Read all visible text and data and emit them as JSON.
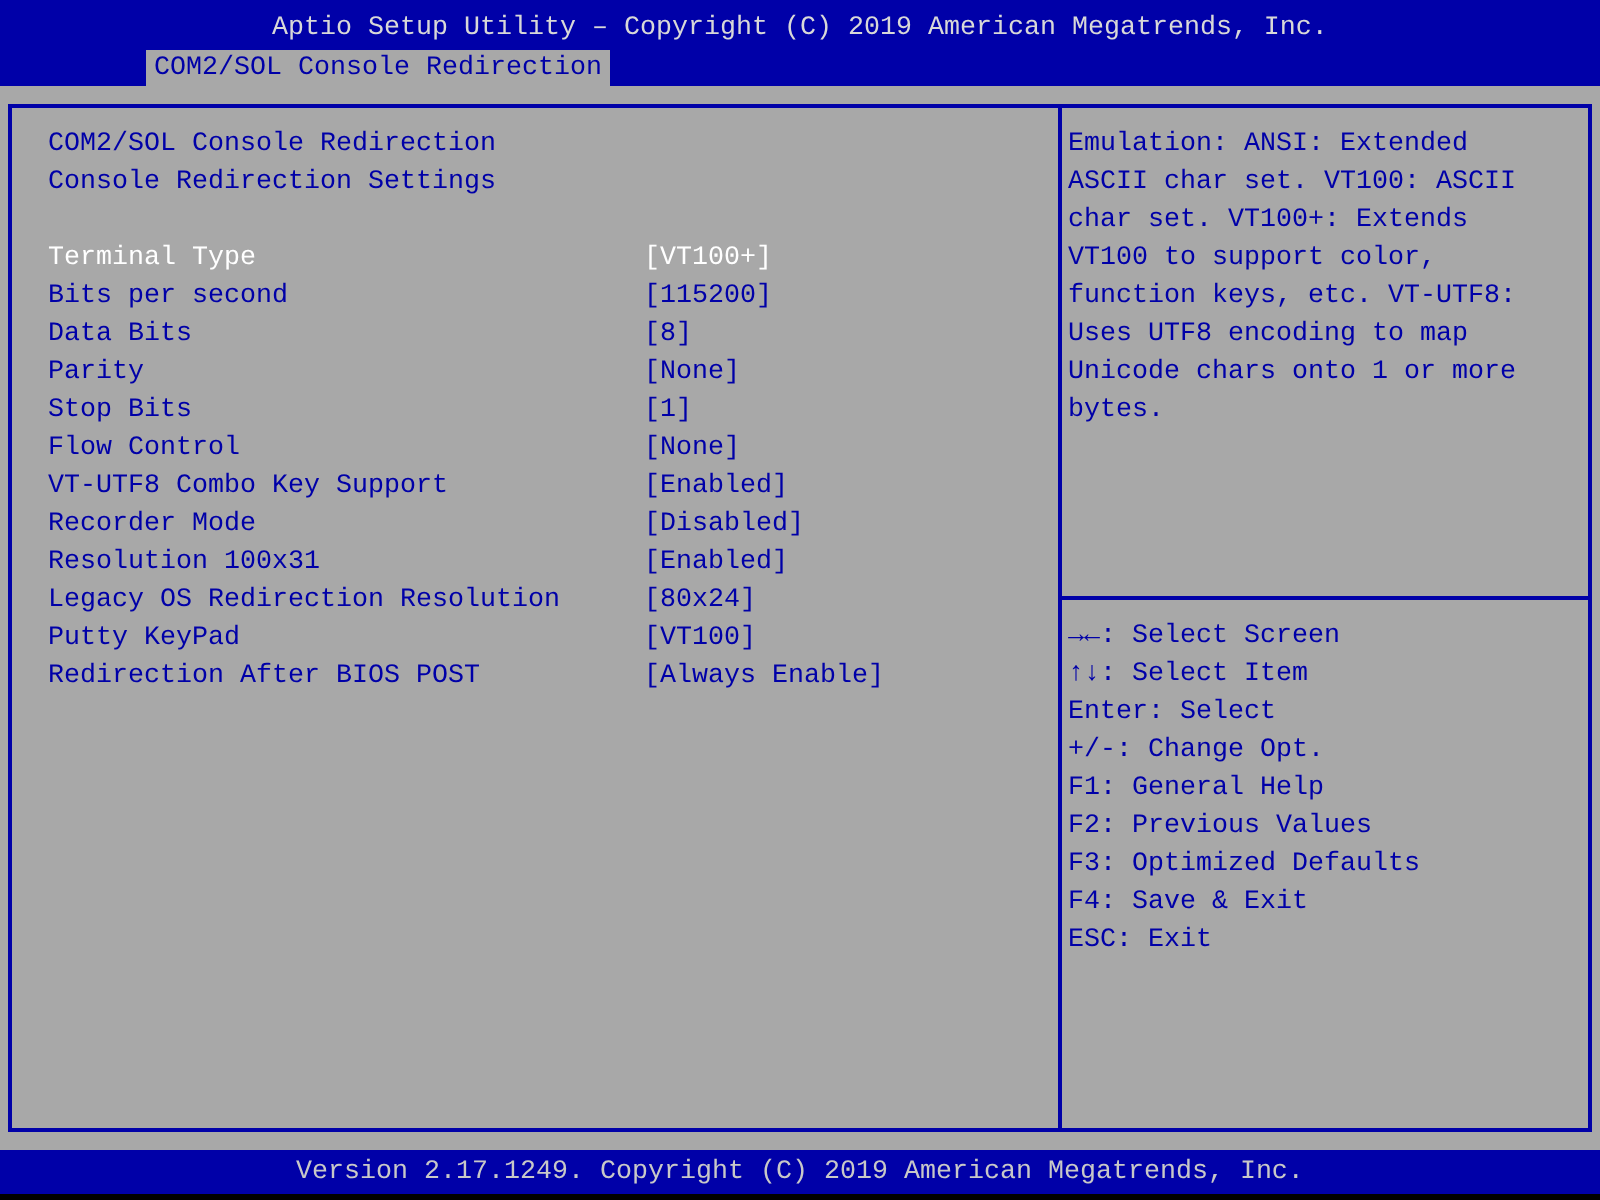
{
  "header": {
    "title": "Aptio Setup Utility – Copyright (C) 2019 American Megatrends, Inc.",
    "tabs": [
      {
        "label": "COM2/SOL Console Redirection",
        "selected": true
      }
    ]
  },
  "headings": [
    "COM2/SOL Console Redirection",
    "Console Redirection Settings"
  ],
  "settings": [
    {
      "label": "Terminal Type",
      "value": "[VT100+]",
      "selected": true
    },
    {
      "label": "Bits per second",
      "value": "[115200]",
      "selected": false
    },
    {
      "label": "Data Bits",
      "value": "[8]",
      "selected": false
    },
    {
      "label": "Parity",
      "value": "[None]",
      "selected": false
    },
    {
      "label": "Stop Bits",
      "value": "[1]",
      "selected": false
    },
    {
      "label": "Flow Control",
      "value": "[None]",
      "selected": false
    },
    {
      "label": "VT-UTF8 Combo Key Support",
      "value": "[Enabled]",
      "selected": false
    },
    {
      "label": "Recorder Mode",
      "value": "[Disabled]",
      "selected": false
    },
    {
      "label": "Resolution 100x31",
      "value": "[Enabled]",
      "selected": false
    },
    {
      "label": "Legacy OS Redirection Resolution",
      "value": "[80x24]",
      "selected": false
    },
    {
      "label": "Putty KeyPad",
      "value": "[VT100]",
      "selected": false
    },
    {
      "label": "Redirection After BIOS POST",
      "value": "[Always Enable]",
      "selected": false
    }
  ],
  "help_text": "Emulation: ANSI: Extended ASCII char set. VT100: ASCII char set. VT100+: Extends VT100 to support color, function keys, etc. VT-UTF8: Uses UTF8 encoding to map Unicode chars onto 1 or more bytes.",
  "key_help": [
    "→←: Select Screen",
    "↑↓: Select Item",
    "Enter: Select",
    "+/-: Change Opt.",
    "F1: General Help",
    "F2: Previous Values",
    "F3: Optimized Defaults",
    "F4: Save & Exit",
    "ESC: Exit"
  ],
  "footer": "Version 2.17.1249. Copyright (C) 2019 American Megatrends, Inc."
}
